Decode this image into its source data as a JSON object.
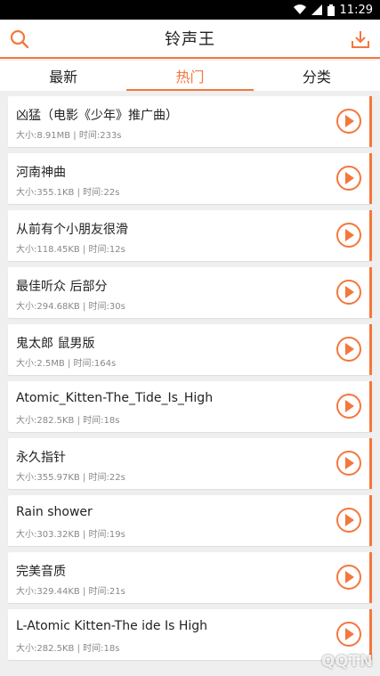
{
  "status_bar": {
    "time": "11:29"
  },
  "header": {
    "title": "铃声王",
    "search_icon": "search-icon",
    "download_icon": "download-icon"
  },
  "tabs": [
    {
      "label": "最新",
      "active": false
    },
    {
      "label": "热门",
      "active": true
    },
    {
      "label": "分类",
      "active": false
    }
  ],
  "items": [
    {
      "name": "凶猛（电影《少年》推广曲）",
      "meta": "大小:8.91MB | 时间:233s"
    },
    {
      "name": "河南神曲",
      "meta": "大小:355.1KB | 时间:22s"
    },
    {
      "name": "从前有个小朋友很滑",
      "meta": "大小:118.45KB | 时间:12s"
    },
    {
      "name": "最佳听众 后部分",
      "meta": "大小:294.68KB | 时间:30s"
    },
    {
      "name": "鬼太郎 鼠男版",
      "meta": "大小:2.5MB | 时间:164s"
    },
    {
      "name": "Atomic_Kitten-The_Tide_Is_High",
      "meta": "大小:282.5KB | 时间:18s"
    },
    {
      "name": "永久指针",
      "meta": "大小:355.97KB | 时间:22s"
    },
    {
      "name": "Rain shower",
      "meta": "大小:303.32KB | 时间:19s"
    },
    {
      "name": "完美音质",
      "meta": "大小:329.44KB | 时间:21s"
    },
    {
      "name": "L-Atomic Kitten-The ide Is High",
      "meta": "大小:282.5KB | 时间:18s"
    }
  ],
  "colors": {
    "accent": "#f4773d"
  },
  "watermark": "QQTN"
}
